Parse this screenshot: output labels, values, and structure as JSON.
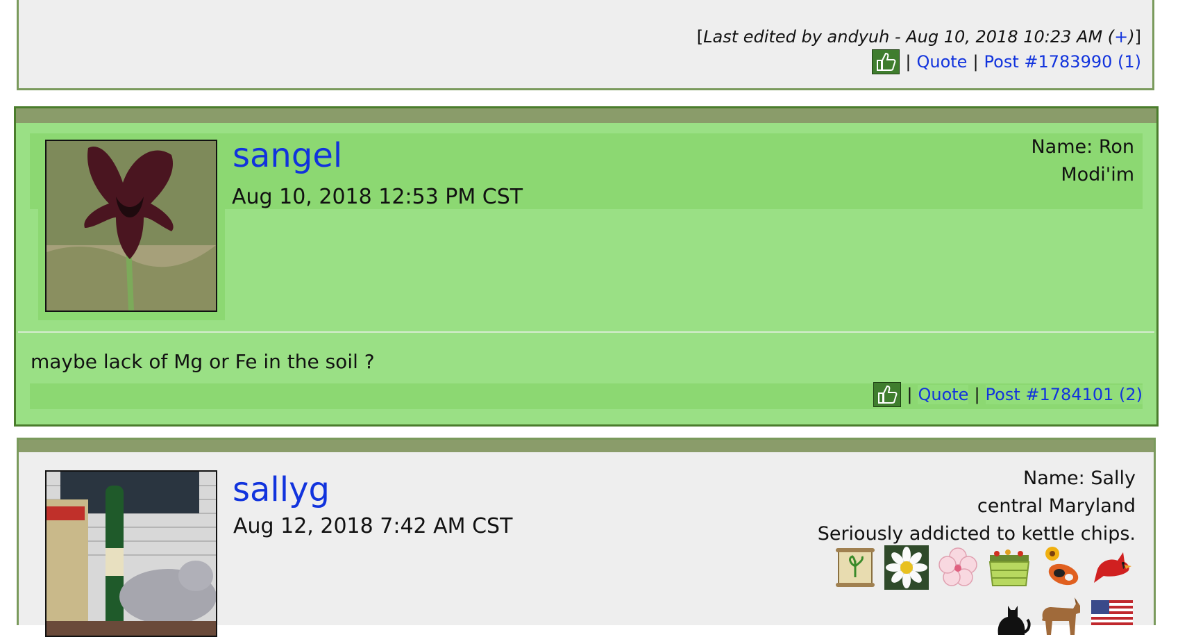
{
  "posts": [
    {
      "edit_note": {
        "prefix": "Last edited by andyuh - Aug 10, 2018 10:23 AM (",
        "plus": "+",
        "suffix": ")"
      },
      "actions": {
        "quote": "Quote",
        "post_link": "Post #1783990 (1)"
      }
    },
    {
      "username": "sangel",
      "date": "Aug 10, 2018 12:53 PM CST",
      "info": [
        "Name: Ron",
        "Modi'im"
      ],
      "body": "maybe lack of Mg or Fe in the soil ?",
      "actions": {
        "quote": "Quote",
        "post_link": "Post #1784101 (2)"
      },
      "highlight_color": "#9ae085"
    },
    {
      "username": "sallyg",
      "date": "Aug 12, 2018 7:42 AM CST",
      "info": [
        "Name: Sally",
        "central Maryland",
        "Seriously addicted to kettle chips."
      ],
      "badges_row1": [
        "scroll-plant-badge",
        "daisy-badge",
        "pink-flower-badge",
        "garden-bed-badge",
        "sunflower-koi-badge",
        "cardinal-badge"
      ],
      "badges_row2": [
        "black-cat-badge",
        "dog-badge",
        "us-flag-badge"
      ]
    }
  ],
  "colors": {
    "link": "#1133dd",
    "post_border": "#7a9a5c",
    "highlight_border": "#4a7d2c",
    "title_bar": "#8a9c6a",
    "thumb_button": "#3f7d2e"
  }
}
